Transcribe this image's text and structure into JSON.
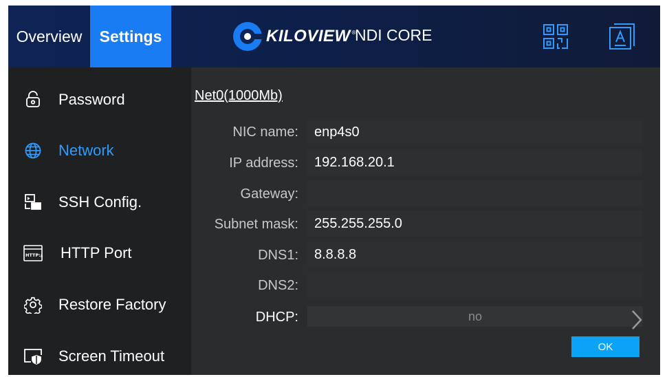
{
  "header": {
    "tabs": [
      {
        "label": "Overview"
      },
      {
        "label": "Settings"
      }
    ],
    "brand": "KILOVIEW",
    "brand_mark": "®",
    "product": "NDI CORE",
    "icons": [
      "qr-code-icon",
      "language-icon"
    ]
  },
  "sidebar": {
    "items": [
      {
        "label": "Password",
        "icon": "lock-icon"
      },
      {
        "label": "Network",
        "icon": "globe-icon"
      },
      {
        "label": "SSH Config.",
        "icon": "ssh-terminal-icon"
      },
      {
        "label": "HTTP Port",
        "icon": "http-window-icon"
      },
      {
        "label": "Restore Factory",
        "icon": "gear-icon"
      },
      {
        "label": "Screen Timeout",
        "icon": "screen-shield-icon"
      }
    ],
    "active": "Network"
  },
  "network": {
    "section_title": "Net0(1000Mb)",
    "fields": {
      "nic_name": {
        "label": "NIC name:",
        "value": "enp4s0"
      },
      "ip_address": {
        "label": "IP address:",
        "value": "192.168.20.1"
      },
      "gateway": {
        "label": "Gateway:",
        "value": ""
      },
      "subnet_mask": {
        "label": "Subnet mask:",
        "value": "255.255.255.0"
      },
      "dns1": {
        "label": "DNS1:",
        "value": "8.8.8.8"
      },
      "dns2": {
        "label": "DNS2:",
        "value": ""
      },
      "dhcp": {
        "label": "DHCP:",
        "value": "no"
      }
    },
    "ok_label": "OK"
  },
  "colors": {
    "accent": "#1a7cf2",
    "active_text": "#2f9bff",
    "ok_button": "#0aa3f5",
    "header_bg": "#0f2455",
    "sidebar_bg": "#1f2022",
    "panel_bg": "#2b2c2e"
  }
}
